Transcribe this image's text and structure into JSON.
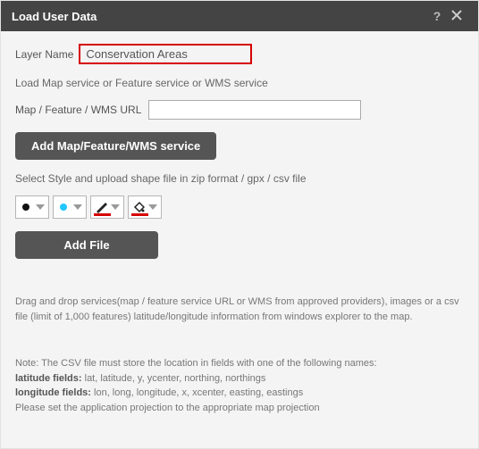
{
  "titlebar": {
    "title": "Load User Data",
    "help": "?"
  },
  "layer": {
    "label": "Layer Name",
    "value": "Conservation Areas"
  },
  "load_services_text": "Load Map service or Feature service or WMS service",
  "url": {
    "label": "Map / Feature / WMS URL",
    "value": ""
  },
  "buttons": {
    "add_service": "Add Map/Feature/WMS service",
    "add_file": "Add File"
  },
  "style_text": "Select Style and upload shape file in zip format / gpx / csv file",
  "hint": "Drag and drop services(map / feature service URL or WMS from approved providers), images or a csv file (limit of 1,000 features) latitude/longitude information from windows explorer to the map.",
  "note": {
    "line1": "Note: The CSV file must store the location in fields with one of the following names:",
    "lat_label": "latitude fields:",
    "lat_values": " lat, latitude, y, ycenter, northing, northings",
    "lon_label": "longitude fields:",
    "lon_values": " lon, long, longitude, x, xcenter, easting, eastings",
    "line4": "Please set the application projection to the appropriate map projection"
  }
}
